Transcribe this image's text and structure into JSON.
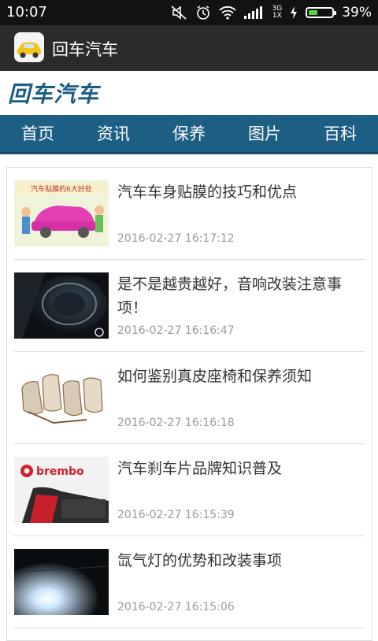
{
  "status": {
    "time": "10:07",
    "net_top": "3G",
    "net_bottom": "1X",
    "battery_pct": "39%",
    "battery_level": 0.39
  },
  "app": {
    "title": "回车汽车",
    "icon": "car-app-icon"
  },
  "logo": {
    "text": "回车汽车"
  },
  "nav": [
    "首页",
    "资讯",
    "保养",
    "图片",
    "百科"
  ],
  "articles": [
    {
      "title": "汽车车身贴膜的技巧和优点",
      "date": "2016-02-27 16:17:12",
      "thumb_caption": "汽车贴膜的6大好处"
    },
    {
      "title": "是不是越贵越好，音响改装注意事项！",
      "date": "2016-02-27 16:16:47"
    },
    {
      "title": "如何鉴别真皮座椅和保养须知",
      "date": "2016-02-27 16:16:18"
    },
    {
      "title": "汽车刹车片品牌知识普及",
      "date": "2016-02-27 16:15:39",
      "thumb_caption": "brembo"
    },
    {
      "title": "氙气灯的优势和改装事项",
      "date": "2016-02-27 16:15:06"
    }
  ]
}
